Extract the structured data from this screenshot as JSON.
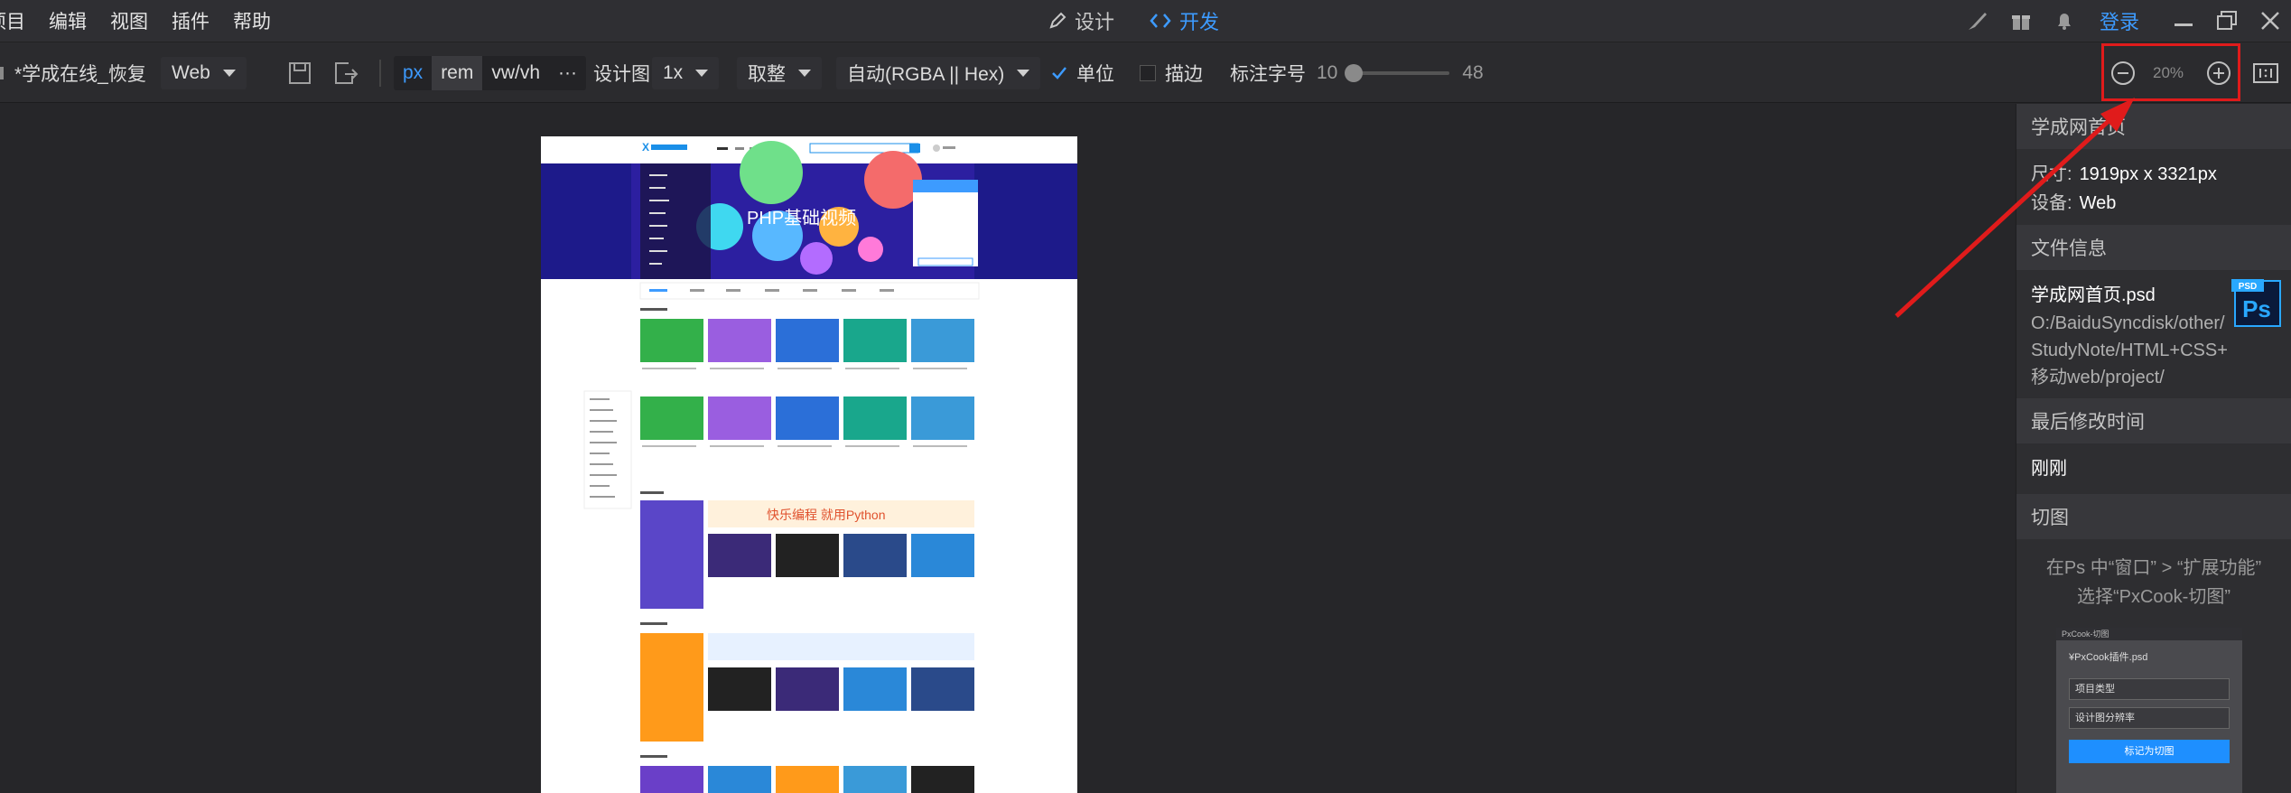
{
  "menu": [
    "项目",
    "编辑",
    "视图",
    "插件",
    "帮助"
  ],
  "modes": {
    "design": "设计",
    "dev": "开发"
  },
  "login": "登录",
  "toolbar": {
    "file_name": "*学成在线_恢复",
    "device": "Web",
    "units": [
      "px",
      "rem",
      "vw/vh",
      "···"
    ],
    "design_label": "设计图",
    "design_scale": "1x",
    "round": "取整",
    "color_mode": "自动(RGBA || Hex)",
    "unit_label": "单位",
    "stroke_label": "描边",
    "font_label": "标注字号",
    "font_min": "10",
    "font_max": "48",
    "zoom": "20%"
  },
  "panel": {
    "title": "学成网首页",
    "size_label": "尺寸:",
    "size_value": "1919px x 3321px",
    "device_label": "设备:",
    "device_value": "Web",
    "file_info_header": "文件信息",
    "file_name": "学成网首页.psd",
    "file_path_1": "O:/BaiduSyncdisk/other/",
    "file_path_2": "StudyNote/HTML+CSS+",
    "file_path_3": "移动web/project/",
    "modified_header": "最后修改时间",
    "modified_value": "刚刚",
    "slice_header": "切图",
    "slice_hint_1": "在Ps 中“窗口” >  “扩展功能”",
    "slice_hint_2": "选择“PxCook-切图”",
    "psd_badge": "PSD",
    "plugin": {
      "title": "PxCook-切图",
      "file": "¥PxCook插件.psd",
      "field1": "项目类型",
      "field2": "设计图分辨率",
      "button": "标记为切图"
    }
  },
  "preview": {
    "banner_text": "PHP基础视频",
    "python_text": "快乐编程   就用Python"
  },
  "colors": {
    "accent": "#3d9bff",
    "highlight": "#e01b1b"
  }
}
